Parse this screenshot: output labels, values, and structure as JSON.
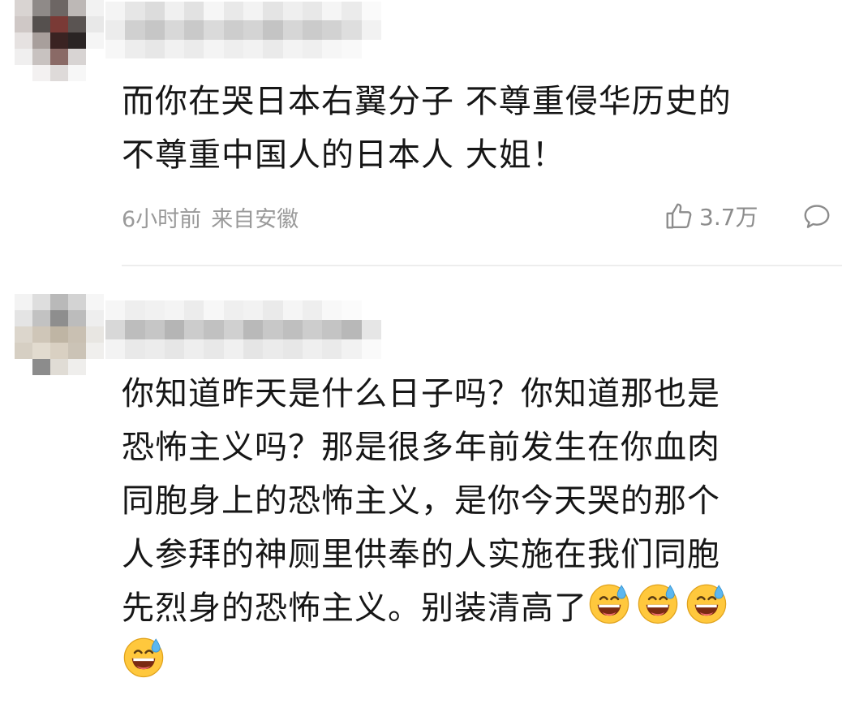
{
  "comments": [
    {
      "text_lines": [
        "而你在哭日本右翼分子 不尊重侵华历史的",
        "不尊重中国人的日本人 大姐！"
      ],
      "time": "6小时前",
      "location": "来自安徽",
      "likes": "3.7万",
      "like_icon": "thumbs-up-icon",
      "reply_icon": "comment-bubble-icon"
    },
    {
      "text_lines": [
        "你知道昨天是什么日子吗？你知道那也是",
        "恐怖主义吗？那是很多年前发生在你血肉",
        "同胞身上的恐怖主义，是你今天哭的那个",
        "人参拜的神厕里供奉的人实施在我们同胞",
        "先烈身的恐怖主义。别装清高了"
      ],
      "emoji_icon": "grinning-sweat-emoji",
      "emoji_count": 4
    }
  ],
  "colors": {
    "text": "#161616",
    "meta": "#9a9a9a",
    "divider": "#ededed",
    "emoji_face": "#ffc83d"
  }
}
